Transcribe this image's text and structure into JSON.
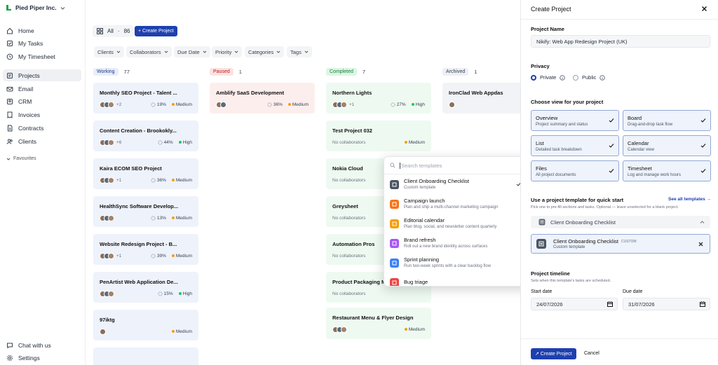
{
  "org": {
    "name": "Pied Piper Inc."
  },
  "nav": {
    "home": "Home",
    "tasks": "My Tasks",
    "timesheet": "My Timesheet",
    "projects": "Projects",
    "email": "Email",
    "crm": "CRM",
    "invoices": "Invoices",
    "contracts": "Contracts",
    "clients": "Clients",
    "favourites": "Favourites",
    "chat": "Chat with us",
    "settings": "Settings"
  },
  "toolbar": {
    "all_label": "All",
    "all_count": "86",
    "create_label": "+ Create Project"
  },
  "filters": [
    "Clients",
    "Collaborators",
    "Due Date",
    "Priority",
    "Categories",
    "Tags"
  ],
  "columns": [
    {
      "label": "Working",
      "count": "77"
    },
    {
      "label": "Paused",
      "count": "1"
    },
    {
      "label": "Completed",
      "count": "7"
    },
    {
      "label": "Archived",
      "count": "1"
    }
  ],
  "cards": {
    "working": [
      {
        "title": "Monthly SEO Project - Talent ...",
        "more": "+2",
        "pct": "19%",
        "priority": "Medium"
      },
      {
        "title": "Content Creation - Brookokly...",
        "more": "+6",
        "pct": "44%",
        "priority": "High"
      },
      {
        "title": "Kaira ECOM SEO Project",
        "more": "+1",
        "pct": "36%",
        "priority": "Medium"
      },
      {
        "title": "HealthSync Software Develop...",
        "more": "",
        "pct": "13%",
        "priority": "Medium"
      },
      {
        "title": "Website Redesign Project - B...",
        "more": "+1",
        "pct": "39%",
        "priority": "Medium"
      },
      {
        "title": "PenArtist Web Application De...",
        "more": "",
        "pct": "15%",
        "priority": "High"
      },
      {
        "title": "97iktg",
        "more": "",
        "pct": "",
        "priority": "Medium"
      }
    ],
    "paused": [
      {
        "title": "Amblify SaaS Development",
        "more": "",
        "pct": "36%",
        "priority": "Medium"
      }
    ],
    "completed": [
      {
        "title": "Northern Lights",
        "more": "+1",
        "pct": "27%",
        "priority": "High"
      },
      {
        "title": "Test Project 032",
        "nocollab": "No collaborators",
        "priority": "Medium"
      },
      {
        "title": "Nokia Cloud",
        "nocollab": "No collaborators"
      },
      {
        "title": "Greysheet",
        "nocollab": "No collaborators"
      },
      {
        "title": "Automation Pros",
        "nocollab": "No collaborators"
      },
      {
        "title": "Product Packaging Mo",
        "nocollab": "No collaborators"
      },
      {
        "title": "Restaurant Menu & Flyer Design",
        "priority": "Medium"
      }
    ],
    "archived": [
      {
        "title": "IronClad Web Appdas"
      }
    ]
  },
  "dropdown": {
    "placeholder": "Search templates",
    "items": [
      {
        "title": "Client Onboarding Checklist",
        "sub": "Custom template",
        "color": "#4b5563"
      },
      {
        "title": "Campaign launch",
        "sub": "Plan and ship a multi-channel marketing campaign",
        "color": "#f97316"
      },
      {
        "title": "Editorial calendar",
        "sub": "Plan blog, social, and newsletter content quarterly",
        "color": "#f59e0b"
      },
      {
        "title": "Brand refresh",
        "sub": "Roll out a new brand identity across surfaces",
        "color": "#a855f7"
      },
      {
        "title": "Sprint planning",
        "sub": "Run two-week sprints with a clear backlog flow",
        "color": "#3b82f6"
      },
      {
        "title": "Bug triage",
        "sub": "",
        "color": "#ef4444"
      }
    ]
  },
  "panel": {
    "title": "Create Project",
    "name_label": "Project Name",
    "name_value": "Nikify: Web App Redesign Project (UK)",
    "privacy_label": "Privacy",
    "private": "Private",
    "public": "Public",
    "view_label": "Choose view for your project",
    "views": [
      {
        "t": "Overview",
        "s": "Project summary and status"
      },
      {
        "t": "Board",
        "s": "Drag-and-drop task flow"
      },
      {
        "t": "List",
        "s": "Detailed task breakdown"
      },
      {
        "t": "Calendar",
        "s": "Calendar view"
      },
      {
        "t": "Files",
        "s": "All project documents"
      },
      {
        "t": "Timesheet",
        "s": "Log and manage work hours"
      }
    ],
    "template_label": "Use a project template for quick start",
    "see_all": "See all templates →",
    "template_hint": "Pick one to pre-fill sections and tasks. Optional — leave unselected for a blank project.",
    "template_select": "Client Onboarding Checklist",
    "selected_title": "Client Onboarding Checklist",
    "selected_tag": "CUSTOM",
    "selected_sub": "Custom template",
    "timeline_label": "Project timeline",
    "timeline_hint": "Sets when this template's tasks are scheduled.",
    "start_label": "Start date",
    "start_value": "24/07/2026",
    "due_label": "Due date",
    "due_value": "31/07/2026",
    "create_btn": "↗ Create Project",
    "cancel_btn": "Cancel"
  }
}
